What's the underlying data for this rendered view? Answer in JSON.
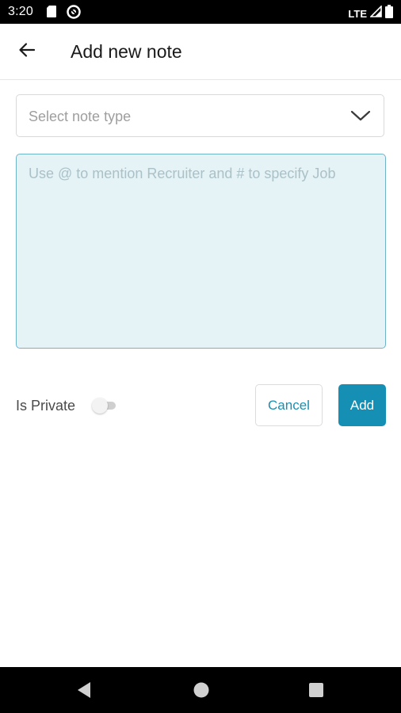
{
  "status_bar": {
    "time": "3:20",
    "network": "LTE",
    "icons": [
      "sd-card-icon",
      "sync-icon",
      "signal-icon",
      "battery-icon"
    ]
  },
  "app_bar": {
    "title": "Add new note",
    "back_icon": "arrow-left-icon"
  },
  "form": {
    "note_type": {
      "placeholder": "Select note type",
      "icon": "chevron-down-icon"
    },
    "note_text": {
      "placeholder": "Use @ to mention Recruiter and # to specify Job",
      "value": ""
    },
    "is_private": {
      "label": "Is Private",
      "checked": false
    },
    "cancel_label": "Cancel",
    "add_label": "Add"
  },
  "nav_bar": {
    "icons": [
      "back-triangle-icon",
      "home-circle-icon",
      "recents-square-icon"
    ]
  },
  "colors": {
    "accent": "#158fb3",
    "textarea_bg": "#e6f3f6",
    "textarea_border": "#6fb3c9"
  }
}
